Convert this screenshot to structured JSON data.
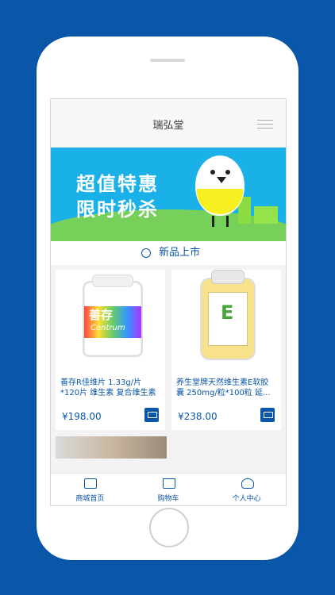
{
  "app": {
    "title": "瑞弘堂"
  },
  "banner": {
    "line1": "超值特惠",
    "line2": "限时秒杀"
  },
  "section": {
    "title": "新品上市"
  },
  "products": [
    {
      "name": "善存R佳维片 1.33g/片 *120片 维生素 复合维生素",
      "price": "¥198.00",
      "image_text": "善存",
      "image_subtext": "Centrum"
    },
    {
      "name": "养生堂牌天然维生素E软胶囊 250mg/粒*100粒 延...",
      "price": "¥238.00",
      "image_text": "E"
    }
  ],
  "bottom_nav": [
    {
      "label": "商城首页",
      "icon": "store-icon"
    },
    {
      "label": "购物车",
      "icon": "cart-icon"
    },
    {
      "label": "个人中心",
      "icon": "user-icon"
    }
  ],
  "colors": {
    "accent": "#0a56a8",
    "banner": "#1ab1e8"
  }
}
